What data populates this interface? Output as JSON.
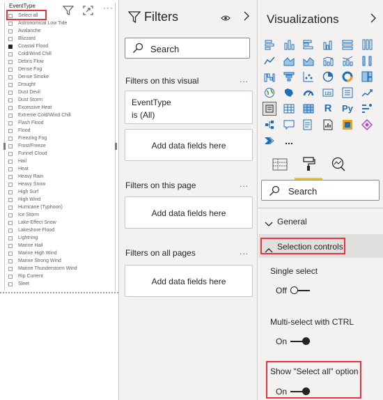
{
  "slicer": {
    "title": "EventType",
    "select_all_label": "Select all",
    "items": [
      {
        "label": "Astronomical Low Tide",
        "checked": false
      },
      {
        "label": "Avalanche",
        "checked": false
      },
      {
        "label": "Blizzard",
        "checked": false
      },
      {
        "label": "Coastal Flood",
        "checked": true
      },
      {
        "label": "Cold/Wind Chill",
        "checked": false
      },
      {
        "label": "Debris Flow",
        "checked": false
      },
      {
        "label": "Dense Fog",
        "checked": false
      },
      {
        "label": "Dense Smoke",
        "checked": false
      },
      {
        "label": "Drought",
        "checked": false
      },
      {
        "label": "Dust Devil",
        "checked": false
      },
      {
        "label": "Dust Storm",
        "checked": false
      },
      {
        "label": "Excessive Heat",
        "checked": false
      },
      {
        "label": "Extreme Cold/Wind Chill",
        "checked": false
      },
      {
        "label": "Flash Flood",
        "checked": false
      },
      {
        "label": "Flood",
        "checked": false
      },
      {
        "label": "Freezing Fog",
        "checked": false
      },
      {
        "label": "Frost/Freeze",
        "checked": false
      },
      {
        "label": "Funnel Cloud",
        "checked": false
      },
      {
        "label": "Hail",
        "checked": false
      },
      {
        "label": "Heat",
        "checked": false
      },
      {
        "label": "Heavy Rain",
        "checked": false
      },
      {
        "label": "Heavy Snow",
        "checked": false
      },
      {
        "label": "High Surf",
        "checked": false
      },
      {
        "label": "High Wind",
        "checked": false
      },
      {
        "label": "Hurricane (Typhoon)",
        "checked": false
      },
      {
        "label": "Ice Storm",
        "checked": false
      },
      {
        "label": "Lake-Effect Snow",
        "checked": false
      },
      {
        "label": "Lakeshore Flood",
        "checked": false
      },
      {
        "label": "Lightning",
        "checked": false
      },
      {
        "label": "Marine Hail",
        "checked": false
      },
      {
        "label": "Marine High Wind",
        "checked": false
      },
      {
        "label": "Marine Strong Wind",
        "checked": false
      },
      {
        "label": "Marine Thunderstorm Wind",
        "checked": false
      },
      {
        "label": "Rip Current",
        "checked": false
      },
      {
        "label": "Sleet",
        "checked": false
      }
    ],
    "tool_icons": [
      "filter-icon",
      "focus-mode-icon",
      "more-options-icon"
    ]
  },
  "filters": {
    "title": "Filters",
    "search_label": "Search",
    "on_visual_label": "Filters on this visual",
    "eventtype_field": "EventType",
    "eventtype_value": "is (All)",
    "add_fields_label": "Add data fields here",
    "on_page_label": "Filters on this page",
    "on_all_pages_label": "Filters on all pages",
    "more_label": "...",
    "icons": [
      "filter-icon",
      "eye-icon",
      "chevron-right-icon"
    ]
  },
  "visualizations": {
    "title": "Visualizations",
    "more_label": "...",
    "search_label": "Search",
    "general_label": "General",
    "selection_controls_label": "Selection controls",
    "single_select": {
      "label": "Single select",
      "state": "Off"
    },
    "multi_select": {
      "label": "Multi-select with CTRL",
      "state": "On"
    },
    "show_select_all": {
      "label": "Show \"Select all\" option",
      "state": "On"
    },
    "r_label": "R",
    "py_label": "Py",
    "accent_color": "#f2c811",
    "highlight_color": "#e8323c"
  }
}
